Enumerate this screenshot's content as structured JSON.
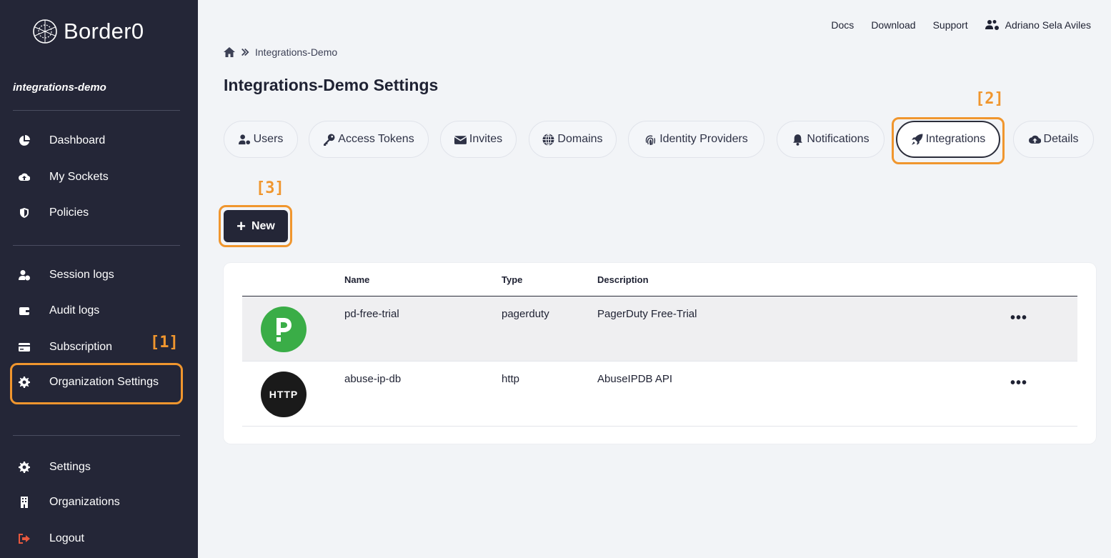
{
  "sidebar": {
    "brand": "Border0",
    "org": "integrations-demo",
    "items": [
      {
        "label": "Dashboard",
        "icon": "pie-chart-icon"
      },
      {
        "label": "My Sockets",
        "icon": "cloud-upload-icon"
      },
      {
        "label": "Policies",
        "icon": "shield-icon"
      },
      {
        "label": "Session logs",
        "icon": "user-clock-icon"
      },
      {
        "label": "Audit logs",
        "icon": "wallet-icon"
      },
      {
        "label": "Subscription",
        "icon": "credit-card-icon"
      },
      {
        "label": "Organization Settings",
        "icon": "gear-icon"
      },
      {
        "label": "Settings",
        "icon": "gear-icon"
      },
      {
        "label": "Organizations",
        "icon": "building-icon"
      },
      {
        "label": "Logout",
        "icon": "sign-out-icon"
      }
    ]
  },
  "header": {
    "links": [
      "Docs",
      "Download",
      "Support"
    ],
    "user": "Adriano Sela Aviles"
  },
  "breadcrumb": {
    "current": "Integrations-Demo"
  },
  "page_title": "Integrations-Demo Settings",
  "tabs": [
    {
      "label": "Users",
      "icon": "user-cog-icon"
    },
    {
      "label": "Access Tokens",
      "icon": "key-icon"
    },
    {
      "label": "Invites",
      "icon": "envelope-icon"
    },
    {
      "label": "Domains",
      "icon": "globe-icon"
    },
    {
      "label": "Identity Providers",
      "icon": "fingerprint-icon"
    },
    {
      "label": "Notifications",
      "icon": "bell-icon"
    },
    {
      "label": "Integrations",
      "icon": "rocket-icon",
      "active": true
    },
    {
      "label": "Details",
      "icon": "cloud-upload-icon"
    }
  ],
  "new_button": "New",
  "annotations": [
    "[1]",
    "[2]",
    "[3]"
  ],
  "table": {
    "headers": [
      "Name",
      "Type",
      "Description"
    ],
    "rows": [
      {
        "name": "pd-free-trial",
        "type": "pagerduty",
        "description": "PagerDuty Free-Trial",
        "logo": "P",
        "menu": "•••"
      },
      {
        "name": "abuse-ip-db",
        "type": "http",
        "description": "AbuseIPDB API",
        "logo": "HTTP",
        "menu": "•••"
      }
    ]
  },
  "colors": {
    "sidebar": "#242637",
    "highlight": "#f0962e",
    "pagerduty": "#3aad47"
  }
}
